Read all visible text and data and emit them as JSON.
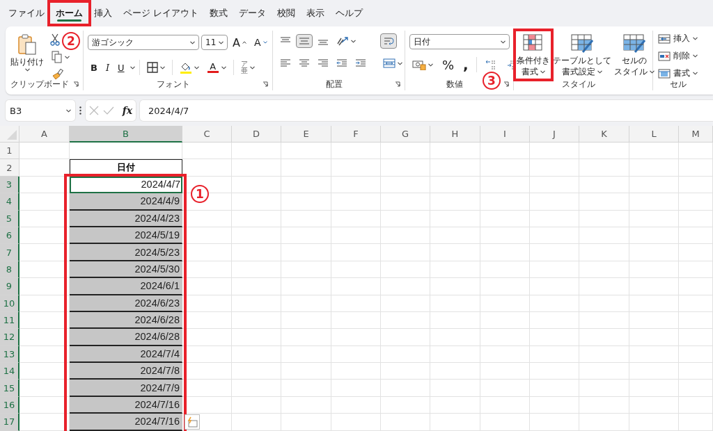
{
  "menu_tabs": [
    {
      "label": "ファイル",
      "selected": false
    },
    {
      "label": "ホーム",
      "selected": true
    },
    {
      "label": "挿入",
      "selected": false
    },
    {
      "label": "ページ レイアウト",
      "selected": false
    },
    {
      "label": "数式",
      "selected": false
    },
    {
      "label": "データ",
      "selected": false
    },
    {
      "label": "校閲",
      "selected": false
    },
    {
      "label": "表示",
      "selected": false
    },
    {
      "label": "ヘルプ",
      "selected": false
    }
  ],
  "clipboard": {
    "paste": "貼り付け",
    "group_label": "クリップボード"
  },
  "font": {
    "name": "游ゴシック",
    "size": "11",
    "grow": "A",
    "shrink": "A",
    "bold": "B",
    "italic": "I",
    "underline": "U",
    "font_color": "A",
    "phonetic_top": "ア",
    "phonetic_bottom": "亜",
    "group_label": "フォント"
  },
  "alignment": {
    "vertical": [
      {
        "on": false
      },
      {
        "on": true
      },
      {
        "on": false
      }
    ],
    "wrap_text": {
      "on": true
    },
    "group_label": "配置"
  },
  "number": {
    "format": "日付",
    "percent": "%",
    "comma": ",",
    "group_label": "数値"
  },
  "styles": {
    "buttons": [
      {
        "lines": [
          "条件付き",
          "書式"
        ]
      },
      {
        "lines": [
          "テーブルとして",
          "書式設定"
        ]
      },
      {
        "lines": [
          "セルの",
          "スタイル"
        ]
      }
    ],
    "group_label": "スタイル"
  },
  "cells": {
    "buttons": [
      "挿入",
      "削除",
      "書式"
    ],
    "group_label": "セル"
  },
  "formula_bar": {
    "name_box": "B3",
    "fx": "fx",
    "value": "2024/4/7"
  },
  "sheet": {
    "columns": [
      {
        "label": "A",
        "selected": false
      },
      {
        "label": "B",
        "selected": true
      },
      {
        "label": "C",
        "selected": false
      },
      {
        "label": "D",
        "selected": false
      },
      {
        "label": "E",
        "selected": false
      },
      {
        "label": "F",
        "selected": false
      },
      {
        "label": "G",
        "selected": false
      },
      {
        "label": "H",
        "selected": false
      },
      {
        "label": "I",
        "selected": false
      },
      {
        "label": "J",
        "selected": false
      },
      {
        "label": "K",
        "selected": false
      },
      {
        "label": "L",
        "selected": false
      },
      {
        "label": "M",
        "selected": false
      }
    ],
    "rows": [
      {
        "number": "1",
        "selected": false,
        "kind": "blank"
      },
      {
        "number": "2",
        "selected": false,
        "kind": "header",
        "value": "日付"
      },
      {
        "number": "3",
        "selected": true,
        "kind": "date",
        "value": "2024/4/7",
        "shaded": false,
        "active": true
      },
      {
        "number": "4",
        "selected": true,
        "kind": "date",
        "value": "2024/4/9",
        "shaded": true,
        "active": false
      },
      {
        "number": "5",
        "selected": true,
        "kind": "date",
        "value": "2024/4/23",
        "shaded": true,
        "active": false
      },
      {
        "number": "6",
        "selected": true,
        "kind": "date",
        "value": "2024/5/19",
        "shaded": true,
        "active": false
      },
      {
        "number": "7",
        "selected": true,
        "kind": "date",
        "value": "2024/5/23",
        "shaded": true,
        "active": false
      },
      {
        "number": "8",
        "selected": true,
        "kind": "date",
        "value": "2024/5/30",
        "shaded": true,
        "active": false
      },
      {
        "number": "9",
        "selected": true,
        "kind": "date",
        "value": "2024/6/1",
        "shaded": true,
        "active": false
      },
      {
        "number": "10",
        "selected": true,
        "kind": "date",
        "value": "2024/6/23",
        "shaded": true,
        "active": false
      },
      {
        "number": "11",
        "selected": true,
        "kind": "date",
        "value": "2024/6/28",
        "shaded": true,
        "active": false
      },
      {
        "number": "12",
        "selected": true,
        "kind": "date",
        "value": "2024/6/28",
        "shaded": true,
        "active": false
      },
      {
        "number": "13",
        "selected": true,
        "kind": "date",
        "value": "2024/7/4",
        "shaded": true,
        "active": false
      },
      {
        "number": "14",
        "selected": true,
        "kind": "date",
        "value": "2024/7/8",
        "shaded": true,
        "active": false
      },
      {
        "number": "15",
        "selected": true,
        "kind": "date",
        "value": "2024/7/9",
        "shaded": true,
        "active": false
      },
      {
        "number": "16",
        "selected": true,
        "kind": "date",
        "value": "2024/7/16",
        "shaded": true,
        "active": false
      },
      {
        "number": "17",
        "selected": true,
        "kind": "date",
        "value": "2024/7/16",
        "shaded": true,
        "active": false
      }
    ]
  },
  "annotations": [
    {
      "number": "2"
    },
    {
      "number": "1"
    },
    {
      "number": "3"
    }
  ]
}
